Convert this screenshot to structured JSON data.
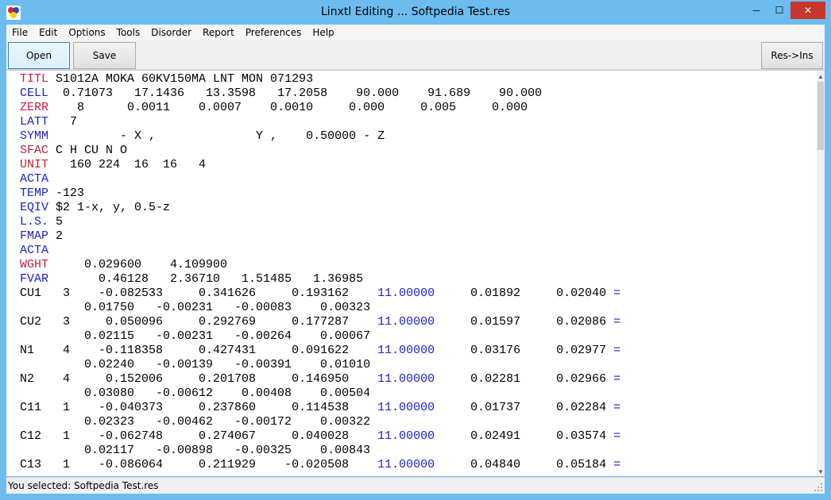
{
  "window": {
    "title": "Linxtl Editing ... Softpedia Test.res",
    "icon": "app-logo-icon",
    "controls": {
      "minimize": "─",
      "maximize": "☐",
      "close": "✕"
    }
  },
  "menu": [
    "File",
    "Edit",
    "Options",
    "Tools",
    "Disorder",
    "Report",
    "Preferences",
    "Help"
  ],
  "toolbar": {
    "open_label": "Open",
    "save_label": "Save",
    "resins_label": "Res->Ins"
  },
  "editor": {
    "lines": [
      {
        "kw": "TITL",
        "kw_color": "red",
        "rest": " S1012A MOKA 60KV150MA LNT MON 071293"
      },
      {
        "kw": "CELL",
        "kw_color": "blue",
        "rest": "  0.71073   17.1436   13.3598   17.2058    90.000    91.689    90.000"
      },
      {
        "kw": "ZERR",
        "kw_color": "red",
        "rest": "    8      0.0011    0.0007    0.0010     0.000     0.005     0.000"
      },
      {
        "kw": "LATT",
        "kw_color": "blue",
        "rest": "   7"
      },
      {
        "kw": "SYMM",
        "kw_color": "blue",
        "rest": "          - X ,              Y ,    0.50000 - Z"
      },
      {
        "kw": "SFAC",
        "kw_color": "red",
        "rest": " C H CU N O"
      },
      {
        "kw": "UNIT",
        "kw_color": "red",
        "rest": "   160 224  16  16   4"
      },
      {
        "kw": "ACTA",
        "kw_color": "blue",
        "rest": ""
      },
      {
        "kw": "TEMP",
        "kw_color": "blue",
        "rest": " -123"
      },
      {
        "kw": "EQIV",
        "kw_color": "blue",
        "rest": " $2 1-x, y, 0.5-z"
      },
      {
        "kw": "L.S.",
        "kw_color": "blue",
        "rest": " 5"
      },
      {
        "kw": "FMAP",
        "kw_color": "blue",
        "rest": " 2"
      },
      {
        "kw": "ACTA",
        "kw_color": "blue",
        "rest": ""
      },
      {
        "kw": "WGHT",
        "kw_color": "red",
        "rest": "     0.029600    4.109900"
      },
      {
        "kw": "FVAR",
        "kw_color": "blue",
        "rest": "       0.46128   2.36710   1.51485   1.36985"
      },
      {
        "kw": "CU1 ",
        "kw_color": "black",
        "rest": "  3    -0.082533     0.341626     0.193162    ",
        "occ": "11.00000",
        "tail": "     0.01892     0.02040 ",
        "eq": "="
      },
      {
        "kw": "",
        "kw_color": "black",
        "rest": "         0.01750   -0.00231   -0.00083    0.00323"
      },
      {
        "kw": "CU2 ",
        "kw_color": "black",
        "rest": "  3     0.050096     0.292769     0.177287    ",
        "occ": "11.00000",
        "tail": "     0.01597     0.02086 ",
        "eq": "="
      },
      {
        "kw": "",
        "kw_color": "black",
        "rest": "         0.02115   -0.00231   -0.00264    0.00067"
      },
      {
        "kw": "N1  ",
        "kw_color": "black",
        "rest": "  4    -0.118358     0.427431     0.091622    ",
        "occ": "11.00000",
        "tail": "     0.03176     0.02977 ",
        "eq": "="
      },
      {
        "kw": "",
        "kw_color": "black",
        "rest": "         0.02240   -0.00139   -0.00391    0.01010"
      },
      {
        "kw": "N2  ",
        "kw_color": "black",
        "rest": "  4     0.152006     0.201708     0.146950    ",
        "occ": "11.00000",
        "tail": "     0.02281     0.02966 ",
        "eq": "="
      },
      {
        "kw": "",
        "kw_color": "black",
        "rest": "         0.03080   -0.00612    0.00408    0.00504"
      },
      {
        "kw": "C11 ",
        "kw_color": "black",
        "rest": "  1    -0.040373     0.237860     0.114538    ",
        "occ": "11.00000",
        "tail": "     0.01737     0.02284 ",
        "eq": "="
      },
      {
        "kw": "",
        "kw_color": "black",
        "rest": "         0.02323   -0.00462   -0.00172    0.00322"
      },
      {
        "kw": "C12 ",
        "kw_color": "black",
        "rest": "  1    -0.062748     0.274067     0.040028    ",
        "occ": "11.00000",
        "tail": "     0.02491     0.03574 ",
        "eq": "="
      },
      {
        "kw": "",
        "kw_color": "black",
        "rest": "         0.02117   -0.00898   -0.00325    0.00843"
      },
      {
        "kw": "C13 ",
        "kw_color": "black",
        "rest": "  1    -0.086064     0.211929    -0.020508    ",
        "occ": "11.00000",
        "tail": "     0.04840     0.05184 ",
        "eq": "="
      }
    ]
  },
  "status": {
    "text": "You selected: Softpedia Test.res"
  }
}
